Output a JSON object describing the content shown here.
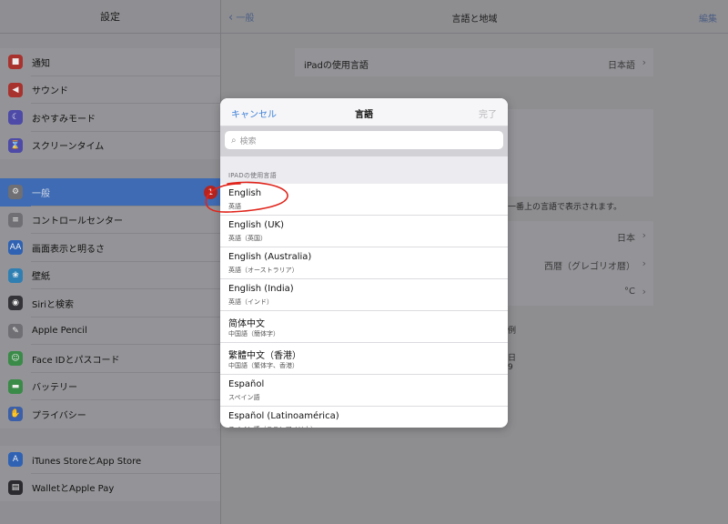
{
  "sidebar": {
    "title": "設定",
    "group1": [
      {
        "label": "通知",
        "icon": "notifications-icon",
        "color": "#a8322e",
        "glyph": "■"
      },
      {
        "label": "サウンド",
        "icon": "sound-icon",
        "color": "#a8322e",
        "glyph": "◀"
      },
      {
        "label": "おやすみモード",
        "icon": "moon-icon",
        "color": "#4d4aa8",
        "glyph": "☾"
      },
      {
        "label": "スクリーンタイム",
        "icon": "hourglass-icon",
        "color": "#4d4aa8",
        "glyph": "⌛"
      }
    ],
    "group2": [
      {
        "label": "一般",
        "icon": "gear-icon",
        "color": "#6f6f74",
        "glyph": "⚙",
        "selected": true,
        "badge": "1"
      },
      {
        "label": "コントロールセンター",
        "icon": "control-center-icon",
        "color": "#6f6f74",
        "glyph": "≡"
      },
      {
        "label": "画面表示と明るさ",
        "icon": "display-brightness-icon",
        "color": "#2f62b3",
        "glyph": "AA"
      },
      {
        "label": "壁紙",
        "icon": "wallpaper-icon",
        "color": "#2f7fb3",
        "glyph": "❀"
      },
      {
        "label": "Siriと検索",
        "icon": "siri-icon",
        "color": "#333338",
        "glyph": "◉"
      },
      {
        "label": "Apple Pencil",
        "icon": "pencil-icon",
        "color": "#6f6f74",
        "glyph": "✎"
      },
      {
        "label": "Face IDとパスコード",
        "icon": "face-id-icon",
        "color": "#3a8a48",
        "glyph": "☺"
      },
      {
        "label": "バッテリー",
        "icon": "battery-icon",
        "color": "#3a8a48",
        "glyph": "▬"
      },
      {
        "label": "プライバシー",
        "icon": "privacy-hand-icon",
        "color": "#3b5fa8",
        "glyph": "✋"
      }
    ],
    "group3": [
      {
        "label": "iTunes StoreとApp Store",
        "icon": "app-store-icon",
        "color": "#2f62b3",
        "glyph": "A"
      },
      {
        "label": "WalletとApple Pay",
        "icon": "wallet-icon",
        "color": "#2b2b2f",
        "glyph": "▤"
      }
    ]
  },
  "detail": {
    "back_label": "一般",
    "title": "言語と地域",
    "edit_label": "編集",
    "ipad_language_label": "iPadの使用言語",
    "ipad_language_value": "日本語",
    "peek_note": "一番上の言語で表示されます。",
    "region_value": "日本",
    "calendar_value": "西暦（グレゴリオ暦）",
    "temperature_value": "°C",
    "peek_example_1": "例",
    "peek_example_2": "日",
    "peek_example_3": "9"
  },
  "modal": {
    "cancel_label": "キャンセル",
    "title": "言語",
    "done_label": "完了",
    "search_placeholder": "検索",
    "section_header": "IPADの使用言語",
    "languages": [
      {
        "name": "English",
        "sub": "英語"
      },
      {
        "name": "English (UK)",
        "sub": "英語（英国）"
      },
      {
        "name": "English (Australia)",
        "sub": "英語（オーストラリア）"
      },
      {
        "name": "English (India)",
        "sub": "英語（インド）"
      },
      {
        "name": "简体中文",
        "sub": "中国語（簡体字）"
      },
      {
        "name": "繁體中文（香港）",
        "sub": "中国語（繁体字、香港）"
      },
      {
        "name": "Español",
        "sub": "スペイン語"
      },
      {
        "name": "Español (Latinoamérica)",
        "sub": "スペイン語（ラテンアメリカ）"
      }
    ]
  },
  "colors": {
    "accent": "#3b7fd8",
    "selected": "#3e6bb3",
    "annotation": "#e0241b"
  }
}
